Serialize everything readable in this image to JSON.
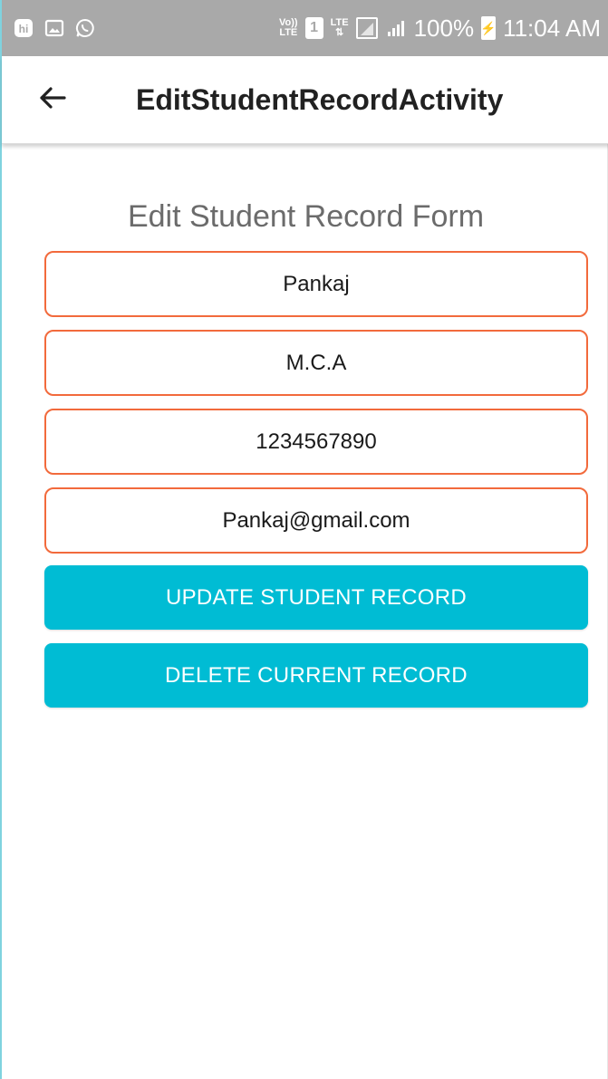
{
  "status_bar": {
    "left_icons": [
      "hike-icon",
      "gallery-icon",
      "whatsapp-icon"
    ],
    "volte_label_top": "Vo))",
    "volte_label_bottom": "LTE",
    "sim_label": "1",
    "lte_label": "LTE",
    "battery_text": "100%",
    "time": "11:04 AM"
  },
  "app_bar": {
    "title": "EditStudentRecordActivity"
  },
  "form": {
    "title": "Edit Student Record Form",
    "fields": [
      {
        "value": "Pankaj"
      },
      {
        "value": "M.C.A"
      },
      {
        "value": "1234567890"
      },
      {
        "value": "Pankaj@gmail.com"
      }
    ],
    "update_label": "UPDATE STUDENT RECORD",
    "delete_label": "DELETE CURRENT RECORD"
  },
  "colors": {
    "status_bar": "#a9a9a9",
    "field_border": "#f26a3c",
    "button": "#00bcd4"
  }
}
